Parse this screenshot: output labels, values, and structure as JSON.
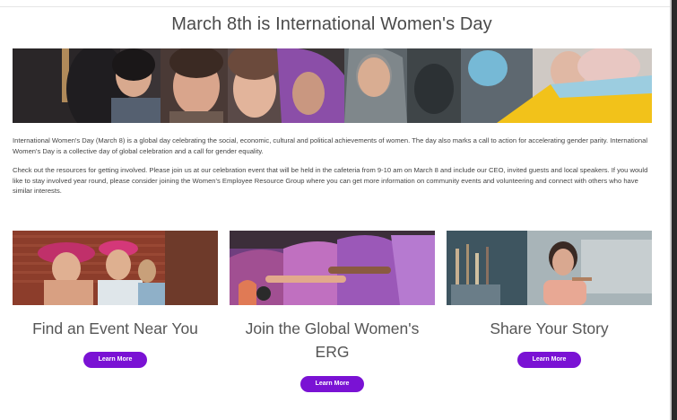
{
  "page": {
    "title": "March 8th is International Women's Day",
    "paragraphs": [
      "International Women's Day (March 8) is a global day celebrating the social, economic, cultural and political achievements of women. The day also marks a call to action for accelerating gender parity. International Women's Day is a collective day of global celebration and a call for gender equality.",
      "Check out the resources for getting involved. Please join us at our celebration event that will be held in the cafeteria from 9-10 am on March 8 and include our CEO, invited guests and local speakers. If you would like to stay involved year round, please consider joining the Women's Employee Resource Group where you can get more information on community events and volunteering and connect with others who have similar interests."
    ]
  },
  "cards": [
    {
      "title": "Find an Event Near You",
      "button": "Learn More"
    },
    {
      "title": "Join the Global Women's ERG",
      "button": "Learn More"
    },
    {
      "title": "Share Your Story",
      "button": "Learn More"
    }
  ],
  "colors": {
    "accent": "#7a12d4",
    "banner_hijab_purple": "#8b4ea8",
    "banner_yellow": "#f2c21a"
  }
}
